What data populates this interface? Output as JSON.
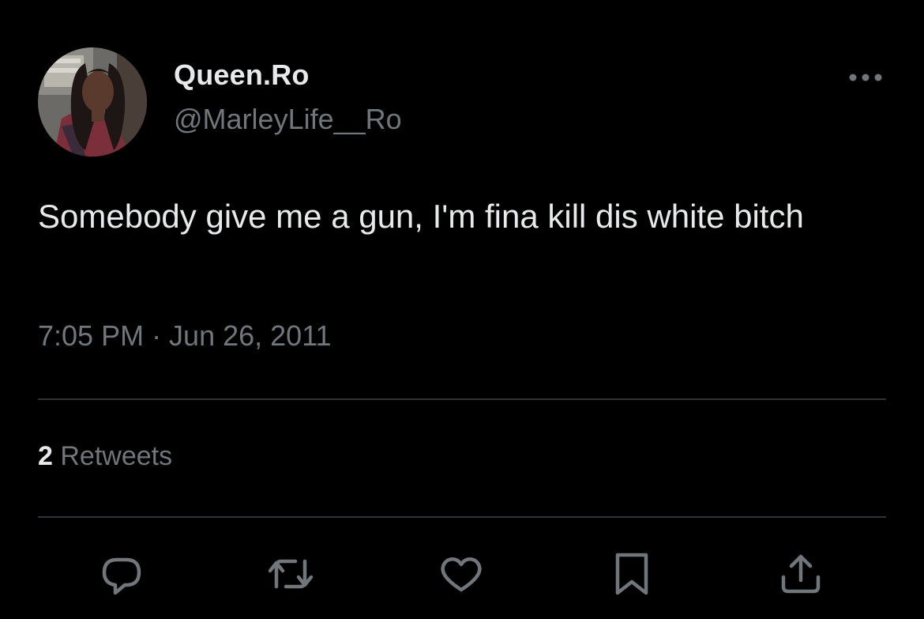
{
  "author": {
    "display_name": "Queen.Ro",
    "handle": "@MarleyLife__Ro",
    "avatar_icon": "profile-photo"
  },
  "tweet": {
    "text": "Somebody give me a gun, I'm fina kill dis white bitch",
    "timestamp": "7:05 PM · Jun 26, 2011"
  },
  "stats": {
    "retweet_count": "2",
    "retweet_label": "Retweets"
  },
  "actions": [
    {
      "name": "reply",
      "icon": "speech-bubble-icon"
    },
    {
      "name": "retweet",
      "icon": "retweet-arrows-icon"
    },
    {
      "name": "like",
      "icon": "heart-icon"
    },
    {
      "name": "bookmark",
      "icon": "bookmark-icon"
    },
    {
      "name": "share",
      "icon": "share-upload-icon"
    }
  ],
  "colors": {
    "background": "#000000",
    "primary_text": "#e7e9ea",
    "secondary_text": "#71767b",
    "divider": "#2f3336"
  }
}
